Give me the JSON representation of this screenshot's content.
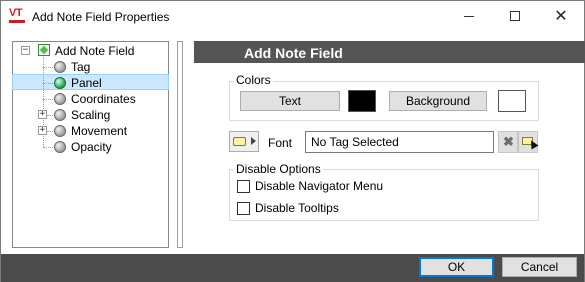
{
  "window": {
    "title": "Add Note Field Properties",
    "app_logo_text": "VT",
    "controls": {
      "minimize": "—",
      "maximize": "☐",
      "close": "✕"
    }
  },
  "tree": {
    "root": "Add Note Field",
    "items": [
      {
        "label": "Tag",
        "state": "gray"
      },
      {
        "label": "Panel",
        "state": "green",
        "selected": true
      },
      {
        "label": "Coordinates",
        "state": "gray"
      },
      {
        "label": "Scaling",
        "state": "gray",
        "expandable": true
      },
      {
        "label": "Movement",
        "state": "gray",
        "expandable": true
      },
      {
        "label": "Opacity",
        "state": "gray"
      }
    ],
    "expander_collapsed": "+",
    "expander_expanded": "−"
  },
  "panel": {
    "title": "Add Note Field",
    "colors": {
      "group_label": "Colors",
      "text_button": "Text",
      "text_color": "#000000",
      "background_button": "Background",
      "background_color": "#FFFFFF"
    },
    "font": {
      "label": "Font",
      "value": "No Tag Selected",
      "clear_icon": "x-icon",
      "pick_icon": "tag-picker-icon"
    },
    "disable_options": {
      "group_label": "Disable Options",
      "navigator_menu": {
        "label": "Disable Navigator Menu",
        "checked": false
      },
      "tooltips": {
        "label": "Disable Tooltips",
        "checked": false
      }
    }
  },
  "footer": {
    "ok_label": "OK",
    "cancel_label": "Cancel"
  },
  "colors": {
    "header_bg": "#555555",
    "footer_bg": "#4b4b4b",
    "selection_bg": "#cce8ff",
    "accent": "#0078d7"
  }
}
